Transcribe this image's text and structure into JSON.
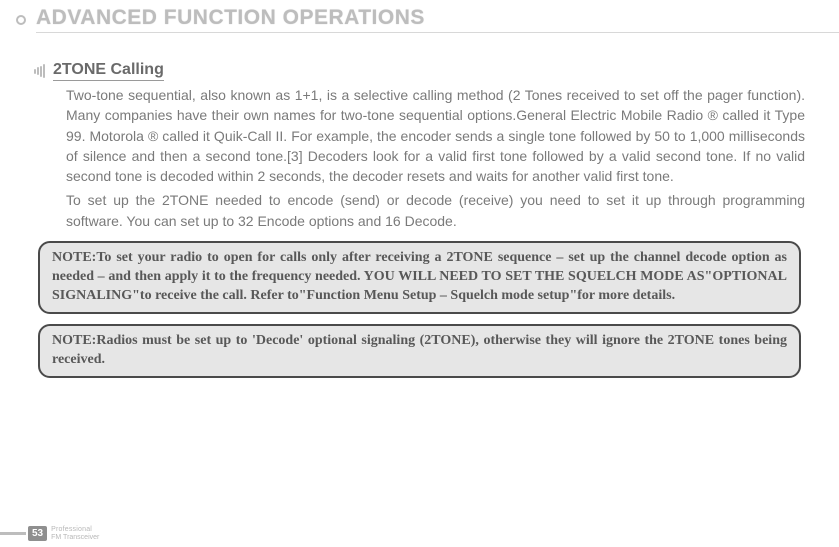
{
  "header": {
    "title": "ADVANCED FUNCTION OPERATIONS"
  },
  "section": {
    "title": "2TONE Calling",
    "para1": "Two-tone sequential, also known as 1+1, is a selective calling method (2 Tones received to set off the pager function). Many companies have their own names for two-tone sequential options.General Electric Mobile Radio ® called it Type 99. Motorola ® called it Quik-Call II. For example, the encoder sends a single tone followed by 50 to 1,000 milliseconds of silence and then a second tone.[3] Decoders look for a valid first tone followed by a valid second tone.  If no valid second tone is decoded within 2 seconds, the decoder resets and waits for another valid first tone.",
    "para2": "To set up the 2TONE needed to encode (send) or decode (receive) you need to set it up through programming software. You can set up to 32 Encode options and 16 Decode."
  },
  "notes": {
    "note1": "NOTE:To set your radio to open for calls only after receiving a 2TONE sequence – set up the channel decode option as needed – and then apply it to the frequency needed. YOU WILL NEED TO SET THE SQUELCH MODE AS\"OPTIONAL SIGNALING\"to receive the call. Refer to\"Function Menu Setup – Squelch mode setup\"for more details.",
    "note2": "NOTE:Radios must be set up to 'Decode' optional signaling (2TONE), otherwise they will ignore the 2TONE tones being received."
  },
  "footer": {
    "page": "53",
    "line1": "Professional",
    "line2": "FM Transceiver"
  }
}
